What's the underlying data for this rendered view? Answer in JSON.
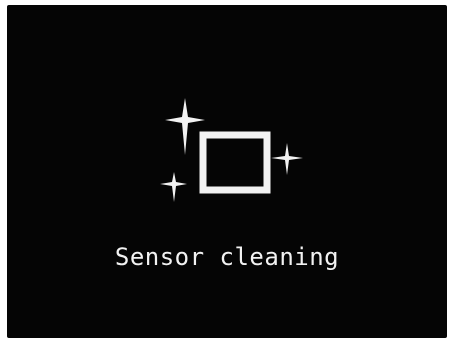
{
  "screen": {
    "message": "Sensor cleaning",
    "icon": "sensor-cleaning-icon",
    "colors": {
      "background": "#050505",
      "foreground": "#f2f2f2"
    }
  }
}
